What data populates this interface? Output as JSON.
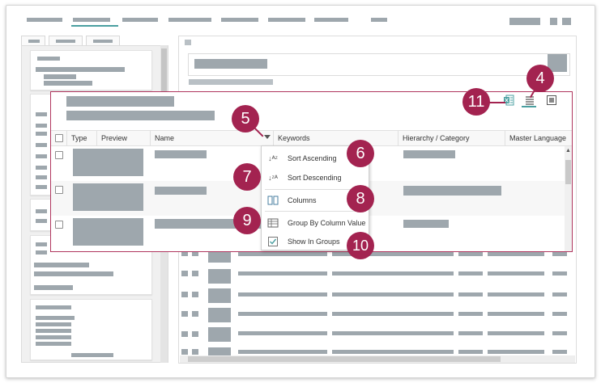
{
  "grid": {
    "columns": {
      "type": "Type",
      "preview": "Preview",
      "name": "Name",
      "keywords": "Keywords",
      "hierarchy": "Hierarchy / Category",
      "master_language": "Master Language"
    }
  },
  "column_menu": {
    "items": [
      {
        "label": "Sort Ascending",
        "icon": "sort-ascending-icon"
      },
      {
        "label": "Sort Descending",
        "icon": "sort-descending-icon"
      },
      {
        "label": "Columns",
        "icon": "columns-icon"
      },
      {
        "label": "Group By Column Value",
        "icon": "group-by-icon"
      },
      {
        "label": "Show In Groups",
        "icon": "checkbox-checked-icon"
      }
    ]
  },
  "callouts": {
    "c4": "4",
    "c5": "5",
    "c6": "6",
    "c7": "7",
    "c8": "8",
    "c9": "9",
    "c10": "10",
    "c11": "11"
  },
  "colors": {
    "callout": "#a32350",
    "highlight_border": "#b0365e",
    "accent": "#4a9fa0",
    "placeholder": "#9ea7ad"
  }
}
